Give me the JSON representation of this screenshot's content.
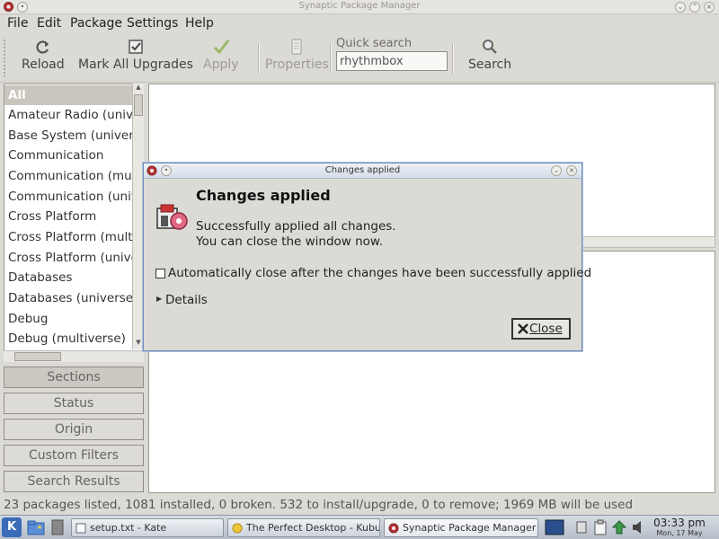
{
  "window": {
    "title": "Synaptic Package Manager"
  },
  "menu": {
    "file": "File",
    "edit": "Edit",
    "package": "Package",
    "settings": "Settings",
    "help": "Help"
  },
  "toolbar": {
    "reload": "Reload",
    "mark_all_upgrades": "Mark All Upgrades",
    "apply": "Apply",
    "properties": "Properties",
    "search": "Search",
    "quick_search_label": "Quick search",
    "quick_search_value": "rhythmbox"
  },
  "sidebar": {
    "items": [
      {
        "label": "All",
        "selected": true
      },
      {
        "label": "Amateur Radio (universe)"
      },
      {
        "label": "Base System (universe)"
      },
      {
        "label": "Communication"
      },
      {
        "label": "Communication (multiverse)"
      },
      {
        "label": "Communication (universe)"
      },
      {
        "label": "Cross Platform"
      },
      {
        "label": "Cross Platform (multiverse)"
      },
      {
        "label": "Cross Platform (universe)"
      },
      {
        "label": "Databases"
      },
      {
        "label": "Databases (universe)"
      },
      {
        "label": "Debug"
      },
      {
        "label": "Debug (multiverse)"
      }
    ]
  },
  "filters": {
    "sections": "Sections",
    "status": "Status",
    "origin": "Origin",
    "custom_filters": "Custom Filters",
    "search_results": "Search Results"
  },
  "statusbar": {
    "text": "23 packages listed, 1081 installed, 0 broken. 532 to install/upgrade, 0 to remove; 1969 MB will be used"
  },
  "dialog": {
    "title": "Changes applied",
    "heading": "Changes applied",
    "message_line1": "Successfully applied all changes.",
    "message_line2": "You can close the window now.",
    "auto_close_label": "Automatically close after the changes have been successfully applied",
    "auto_close_checked": false,
    "details_label": "Details",
    "close_button": "Close"
  },
  "taskbar": {
    "tasks": [
      {
        "label": "setup.txt - Kate"
      },
      {
        "label": "The Perfect Desktop - Kubuntu"
      },
      {
        "label": "Synaptic Package Manager",
        "active": true
      }
    ],
    "clock_time": "03:33 pm",
    "clock_date": "Mon, 17 May"
  },
  "colors": {
    "window_bg": "#dcdad5",
    "dialog_border": "#6f8db8",
    "selection": "#c9c6bd",
    "taskbar": "#c4cad4"
  }
}
